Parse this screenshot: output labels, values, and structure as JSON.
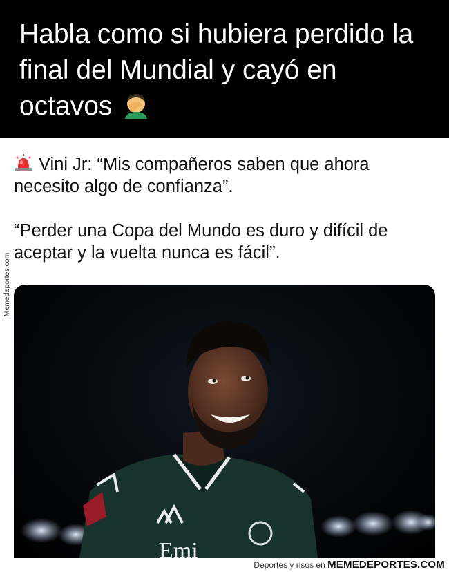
{
  "caption": {
    "text": "Habla como si hubiera perdido la final del Mundial y cayó en octavos",
    "emoji_icon": "man-facepalming-emoji"
  },
  "tweet": {
    "siren_icon": "police-siren-emoji",
    "line1": "Vini Jr: “Mis compañeros saben que ahora necesito algo de confianza”.",
    "line2": "“Perder una Copa del Mundo es duro y difícil de aceptar y la vuelta nunca es fácil”."
  },
  "watermark": {
    "side": "Memedeportes.com",
    "footer_prefix": "Deportes y risos en",
    "footer_brand": "MEMEDEPORTES.COM"
  },
  "photo": {
    "description_icon": "player-photo"
  }
}
